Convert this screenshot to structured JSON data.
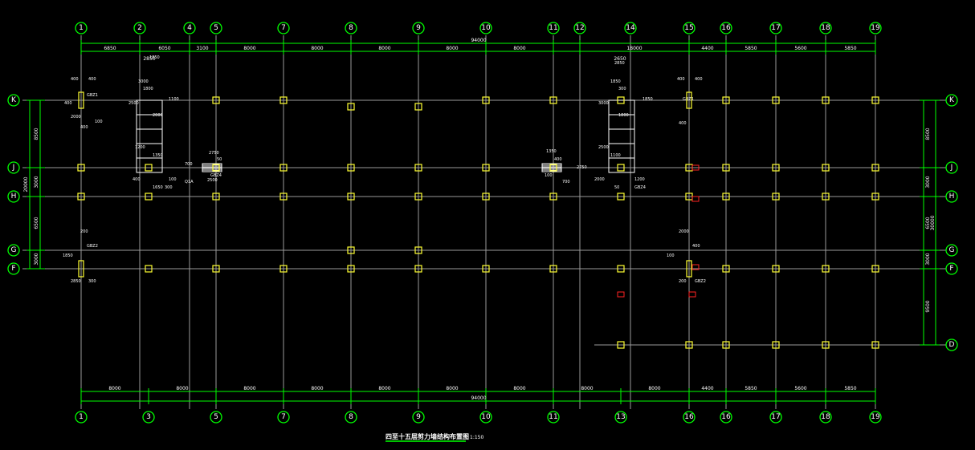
{
  "colors": {
    "background": "#000000",
    "axis": "#9a9a9a",
    "dimension": "#00ff00",
    "column": "#ffff33",
    "accent_red": "#ff2222"
  },
  "top_axes": [
    "1",
    "2",
    "4",
    "5",
    "7",
    "8",
    "9",
    "10",
    "11",
    "12",
    "14",
    "15",
    "16",
    "17",
    "18",
    "19"
  ],
  "bottom_axes": [
    "1",
    "3",
    "5",
    "7",
    "8",
    "9",
    "10",
    "11",
    "13",
    "16",
    "16",
    "17",
    "18",
    "19"
  ],
  "row_axes": [
    "K",
    "J",
    "H",
    "G",
    "F",
    "D"
  ],
  "top_dims": [
    "6850",
    "6050",
    "3100",
    "8000",
    "8000",
    "8000",
    "8000",
    "8000",
    "18000",
    "4400",
    "5850",
    "5600",
    "5850"
  ],
  "top_total": "94000",
  "top_sub_left": "2850",
  "top_sub_right": "2650",
  "bottom_dims": [
    "8000",
    "8000",
    "8000",
    "8000",
    "8000",
    "8000",
    "8000",
    "8000",
    "8000",
    "4400",
    "5850",
    "5600",
    "5850"
  ],
  "bottom_total": "94000",
  "left_dims": [
    "8500",
    "3000",
    "6500",
    "3000"
  ],
  "left_total": "20000",
  "right_dims": [
    "8500",
    "3000",
    "6500",
    "3000",
    "9500"
  ],
  "right_total": "30000",
  "core_labels": [
    "400",
    "400",
    "GBZ1",
    "400",
    "2000",
    "400",
    "100",
    "200",
    "GBZ2",
    "1850",
    "2850",
    "300",
    "3000",
    "1850",
    "1800",
    "2500",
    "1100",
    "2000",
    "1200",
    "1350",
    "400",
    "100",
    "700",
    "2750",
    "50",
    "GBZ4",
    "Q1A",
    "2500",
    "1650",
    "300"
  ],
  "title": "四至十五层剪力墙结构布置图",
  "scale": "1:150"
}
